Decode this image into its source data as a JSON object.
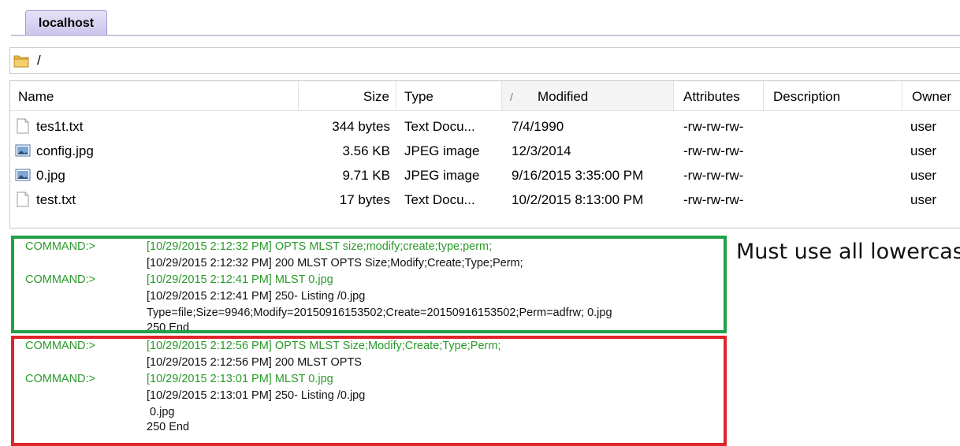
{
  "tabs": [
    {
      "label": "localhost"
    }
  ],
  "path": {
    "current": "/"
  },
  "file_list": {
    "columns": [
      "Name",
      "Size",
      "Type",
      "Modified",
      "Attributes",
      "Description",
      "Owner"
    ],
    "sort_indicator": "/",
    "rows": [
      {
        "name": "tes1t.txt",
        "size": "344 bytes",
        "type": "Text Docu...",
        "modified": "7/4/1990",
        "attributes": "-rw-rw-rw-",
        "description": "",
        "owner": "user",
        "icon": "text-file-icon"
      },
      {
        "name": "config.jpg",
        "size": "3.56 KB",
        "type": "JPEG image",
        "modified": "12/3/2014",
        "attributes": "-rw-rw-rw-",
        "description": "",
        "owner": "user",
        "icon": "image-file-icon"
      },
      {
        "name": "0.jpg",
        "size": "9.71 KB",
        "type": "JPEG image",
        "modified": "9/16/2015 3:35:00 PM",
        "attributes": "-rw-rw-rw-",
        "description": "",
        "owner": "user",
        "icon": "image-file-icon"
      },
      {
        "name": "test.txt",
        "size": "17 bytes",
        "type": "Text Docu...",
        "modified": "10/2/2015 8:13:00 PM",
        "attributes": "-rw-rw-rw-",
        "description": "",
        "owner": "user",
        "icon": "text-file-icon"
      }
    ]
  },
  "log": [
    {
      "prefix": "COMMAND:>",
      "text": "[10/29/2015 2:12:32 PM] OPTS MLST size;modify;create;type;perm;",
      "color": "#2a9a2a"
    },
    {
      "prefix": "",
      "text": "[10/29/2015 2:12:32 PM] 200 MLST OPTS Size;Modify;Create;Type;Perm;",
      "color": "#111111"
    },
    {
      "prefix": "COMMAND:>",
      "text": "[10/29/2015 2:12:41 PM] MLST 0.jpg",
      "color": "#2a9a2a"
    },
    {
      "prefix": "",
      "text": "[10/29/2015 2:12:41 PM] 250- Listing  /0.jpg",
      "color": "#111111"
    },
    {
      "prefix": "",
      "text": "Type=file;Size=9946;Modify=20150916153502;Create=20150916153502;Perm=adfrw; 0.jpg",
      "color": "#111111"
    },
    {
      "prefix": "",
      "text": "250 End",
      "color": "#111111"
    },
    {
      "prefix": "COMMAND:>",
      "text": "[10/29/2015 2:12:56 PM] OPTS MLST Size;Modify;Create;Type;Perm;",
      "color": "#2a9a2a"
    },
    {
      "prefix": "",
      "text": "[10/29/2015 2:12:56 PM] 200 MLST OPTS",
      "color": "#111111"
    },
    {
      "prefix": "COMMAND:>",
      "text": "[10/29/2015 2:13:01 PM] MLST 0.jpg",
      "color": "#2a9a2a"
    },
    {
      "prefix": "",
      "text": "[10/29/2015 2:13:01 PM] 250- Listing  /0.jpg",
      "color": "#111111"
    },
    {
      "prefix": "",
      "text": " 0.jpg",
      "color": "#111111"
    },
    {
      "prefix": "",
      "text": "250 End",
      "color": "#111111"
    }
  ],
  "annotation": {
    "text": "Must use all lowercas",
    "green_box_color": "#21a04a",
    "red_box_color": "#e0242b"
  }
}
